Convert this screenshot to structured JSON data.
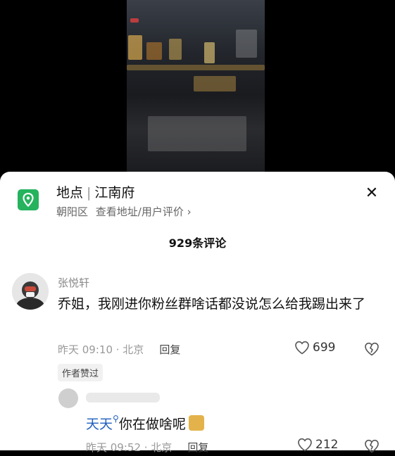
{
  "location": {
    "prefix": "地点",
    "name": "江南府",
    "district": "朝阳区",
    "links": "查看地址/用户评价",
    "accent_color": "#25b35e"
  },
  "comments_count": "929条评论",
  "comment": {
    "username": "张悦轩",
    "text": "乔姐，我刚进你粉丝群啥话都没说怎么给我踢出来了",
    "time": "昨天 09:10 · 北京",
    "reply_label": "回复",
    "likes": "699",
    "author_badge": "作者赞过"
  },
  "reply": {
    "mention": "天天",
    "text": "你在做啥呢",
    "time": "昨天 09:52 · 北京",
    "reply_label": "回复",
    "likes": "212"
  },
  "icons": {
    "location": "location-pin-icon",
    "close": "close-icon",
    "like": "heart-icon",
    "dislike": "broken-heart-icon",
    "search": "search-icon",
    "cat": "cat-emoji-icon"
  }
}
